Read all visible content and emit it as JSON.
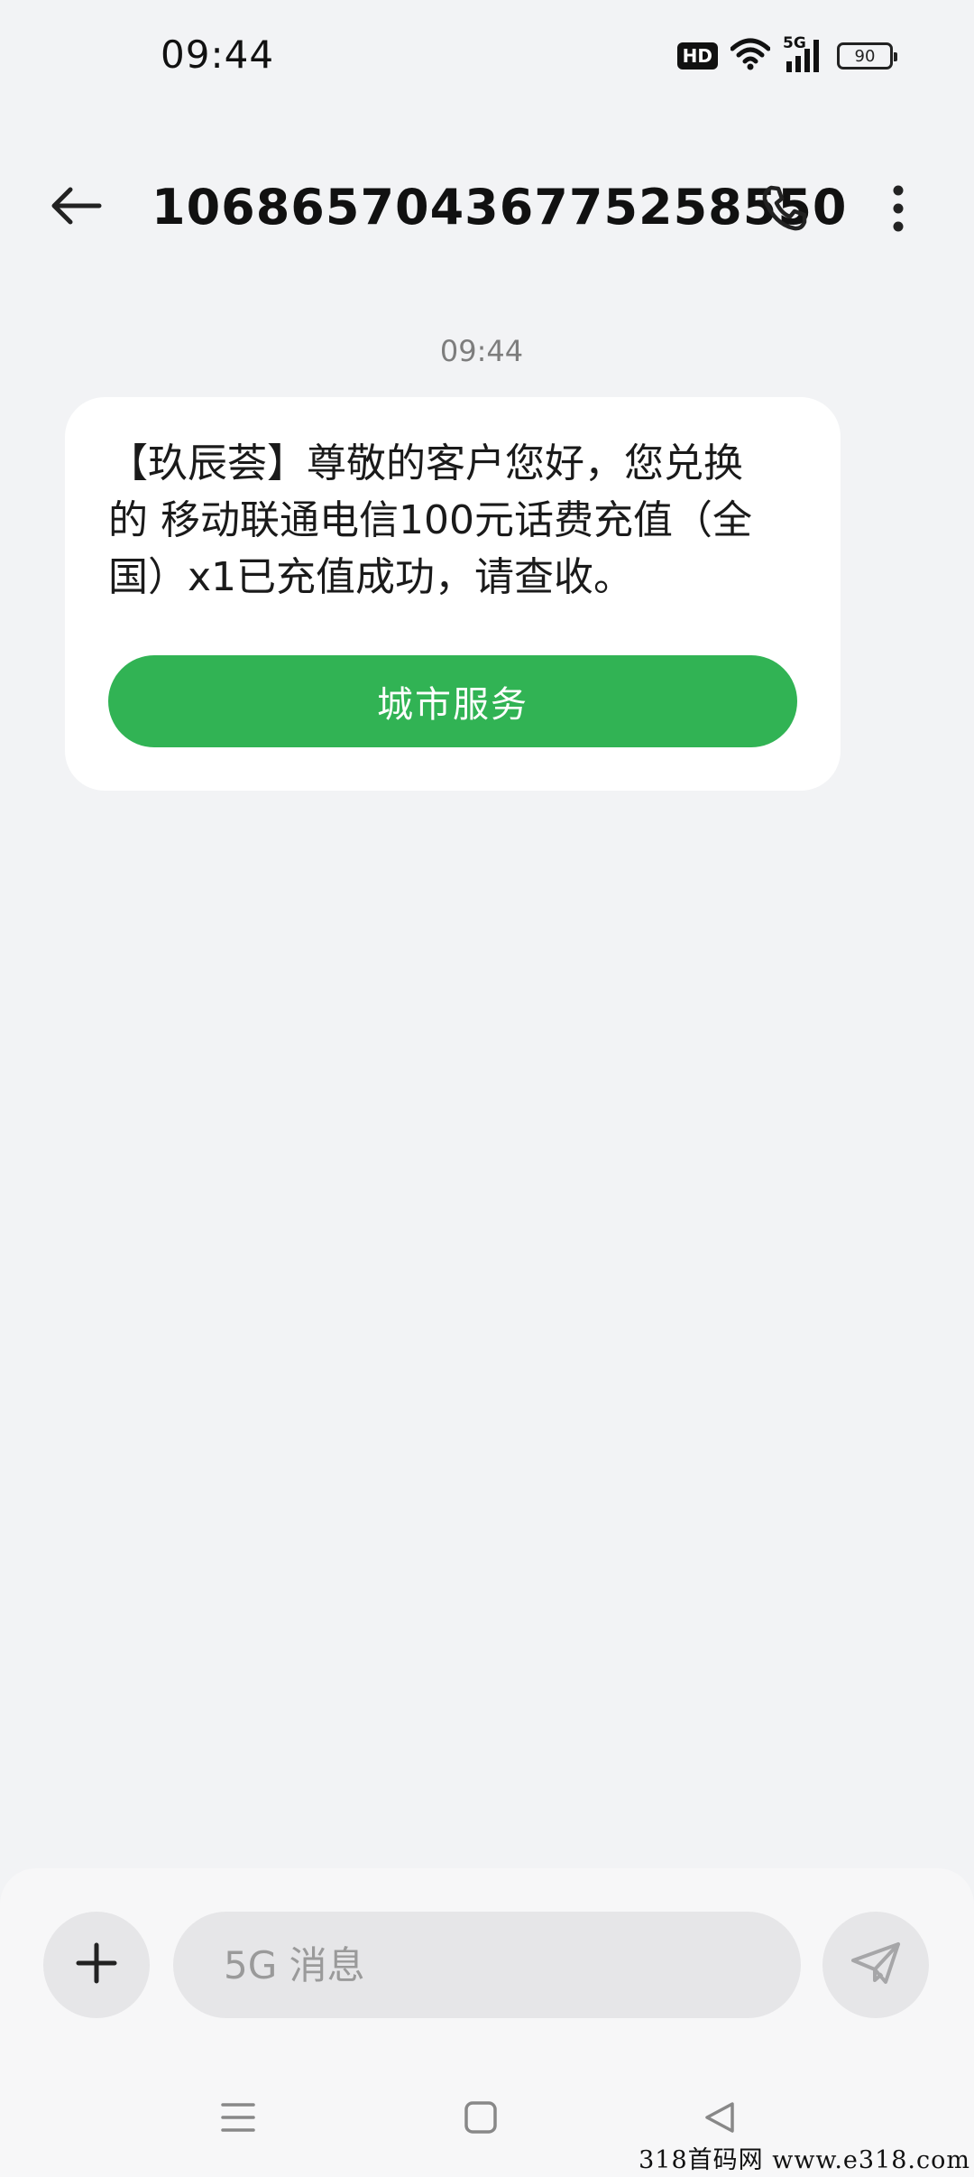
{
  "status_bar": {
    "time": "09:44",
    "hd_label": "HD",
    "network_label": "5G",
    "battery_level": "90"
  },
  "header": {
    "contact_number": "10686570436775258550",
    "icons": {
      "back": "back-arrow-icon",
      "call": "phone-icon",
      "more": "more-vertical-icon"
    }
  },
  "conversation": {
    "timestamp": "09:44",
    "messages": [
      {
        "text": "【玖辰荟】尊敬的客户您好，您兑换的 移动联通电信100元话费充值（全国）x1已充值成功，请查收。",
        "card_button_label": "城市服务",
        "card_button_color": "#31b354"
      }
    ]
  },
  "composer": {
    "input_value": "",
    "input_placeholder": "5G 消息",
    "icons": {
      "add": "plus-icon",
      "send": "send-icon"
    }
  },
  "nav_bar": {
    "icons": [
      "menu-icon",
      "home-icon",
      "back-triangle-icon"
    ]
  },
  "watermark": "318首码网 www.e318.com"
}
